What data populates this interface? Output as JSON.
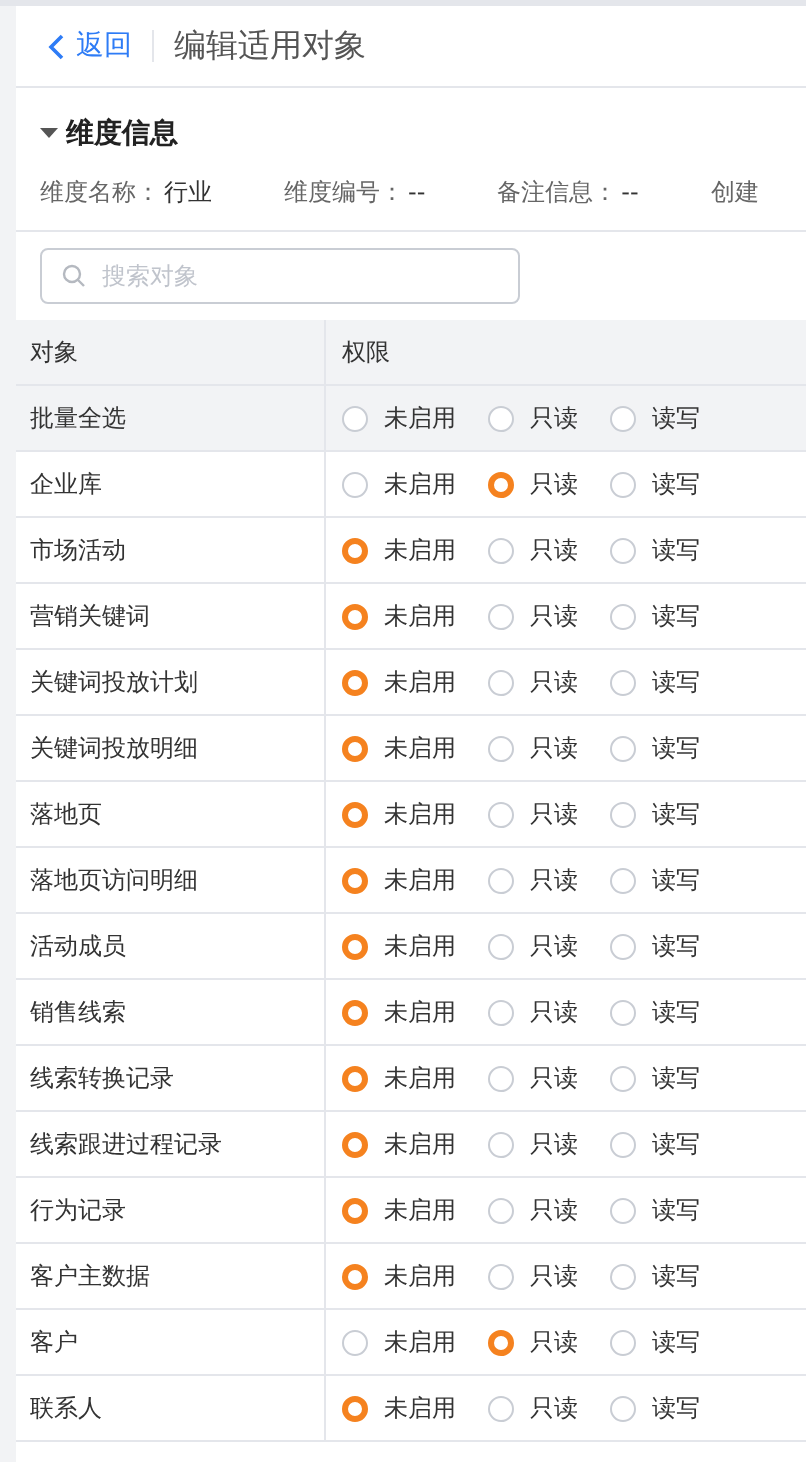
{
  "header": {
    "back": "返回",
    "title": "编辑适用对象"
  },
  "section": {
    "title": "维度信息",
    "expanded": true,
    "fields": [
      {
        "label": "维度名称：",
        "value": "行业"
      },
      {
        "label": "维度编号：",
        "value": "--"
      },
      {
        "label": "备注信息：",
        "value": "--"
      },
      {
        "label": "创建"
      }
    ]
  },
  "search": {
    "placeholder": "搜索对象"
  },
  "table": {
    "columns": [
      "对象",
      "权限"
    ],
    "rows": [
      {
        "name": "批量全选",
        "kind": "batch",
        "options": [
          {
            "label": "未启用",
            "selected": false
          },
          {
            "label": "只读",
            "selected": false
          },
          {
            "label": "读写",
            "selected": false
          }
        ]
      },
      {
        "name": "企业库",
        "kind": "item",
        "options": [
          {
            "label": "未启用",
            "selected": false
          },
          {
            "label": "只读",
            "selected": true
          },
          {
            "label": "读写",
            "selected": false
          }
        ]
      },
      {
        "name": "市场活动",
        "kind": "item",
        "options": [
          {
            "label": "未启用",
            "selected": true
          },
          {
            "label": "只读",
            "selected": false
          },
          {
            "label": "读写",
            "selected": false
          }
        ]
      },
      {
        "name": "营销关键词",
        "kind": "item",
        "options": [
          {
            "label": "未启用",
            "selected": true
          },
          {
            "label": "只读",
            "selected": false
          },
          {
            "label": "读写",
            "selected": false
          }
        ]
      },
      {
        "name": "关键词投放计划",
        "kind": "item",
        "options": [
          {
            "label": "未启用",
            "selected": true
          },
          {
            "label": "只读",
            "selected": false
          },
          {
            "label": "读写",
            "selected": false
          }
        ]
      },
      {
        "name": "关键词投放明细",
        "kind": "item",
        "options": [
          {
            "label": "未启用",
            "selected": true
          },
          {
            "label": "只读",
            "selected": false
          },
          {
            "label": "读写",
            "selected": false
          }
        ]
      },
      {
        "name": "落地页",
        "kind": "item",
        "options": [
          {
            "label": "未启用",
            "selected": true
          },
          {
            "label": "只读",
            "selected": false
          },
          {
            "label": "读写",
            "selected": false
          }
        ]
      },
      {
        "name": "落地页访问明细",
        "kind": "item",
        "options": [
          {
            "label": "未启用",
            "selected": true
          },
          {
            "label": "只读",
            "selected": false
          },
          {
            "label": "读写",
            "selected": false
          }
        ]
      },
      {
        "name": "活动成员",
        "kind": "item",
        "options": [
          {
            "label": "未启用",
            "selected": true
          },
          {
            "label": "只读",
            "selected": false
          },
          {
            "label": "读写",
            "selected": false
          }
        ]
      },
      {
        "name": "销售线索",
        "kind": "item",
        "options": [
          {
            "label": "未启用",
            "selected": true
          },
          {
            "label": "只读",
            "selected": false
          },
          {
            "label": "读写",
            "selected": false
          }
        ]
      },
      {
        "name": "线索转换记录",
        "kind": "item",
        "options": [
          {
            "label": "未启用",
            "selected": true
          },
          {
            "label": "只读",
            "selected": false
          },
          {
            "label": "读写",
            "selected": false
          }
        ]
      },
      {
        "name": "线索跟进过程记录",
        "kind": "item",
        "options": [
          {
            "label": "未启用",
            "selected": true
          },
          {
            "label": "只读",
            "selected": false
          },
          {
            "label": "读写",
            "selected": false
          }
        ]
      },
      {
        "name": "行为记录",
        "kind": "item",
        "options": [
          {
            "label": "未启用",
            "selected": true
          },
          {
            "label": "只读",
            "selected": false
          },
          {
            "label": "读写",
            "selected": false
          }
        ]
      },
      {
        "name": "客户主数据",
        "kind": "item",
        "options": [
          {
            "label": "未启用",
            "selected": true
          },
          {
            "label": "只读",
            "selected": false
          },
          {
            "label": "读写",
            "selected": false
          }
        ]
      },
      {
        "name": "客户",
        "kind": "item",
        "options": [
          {
            "label": "未启用",
            "selected": false
          },
          {
            "label": "只读",
            "selected": true
          },
          {
            "label": "读写",
            "selected": false
          }
        ]
      },
      {
        "name": "联系人",
        "kind": "item",
        "options": [
          {
            "label": "未启用",
            "selected": true
          },
          {
            "label": "只读",
            "selected": false
          },
          {
            "label": "读写",
            "selected": false
          }
        ]
      }
    ]
  }
}
